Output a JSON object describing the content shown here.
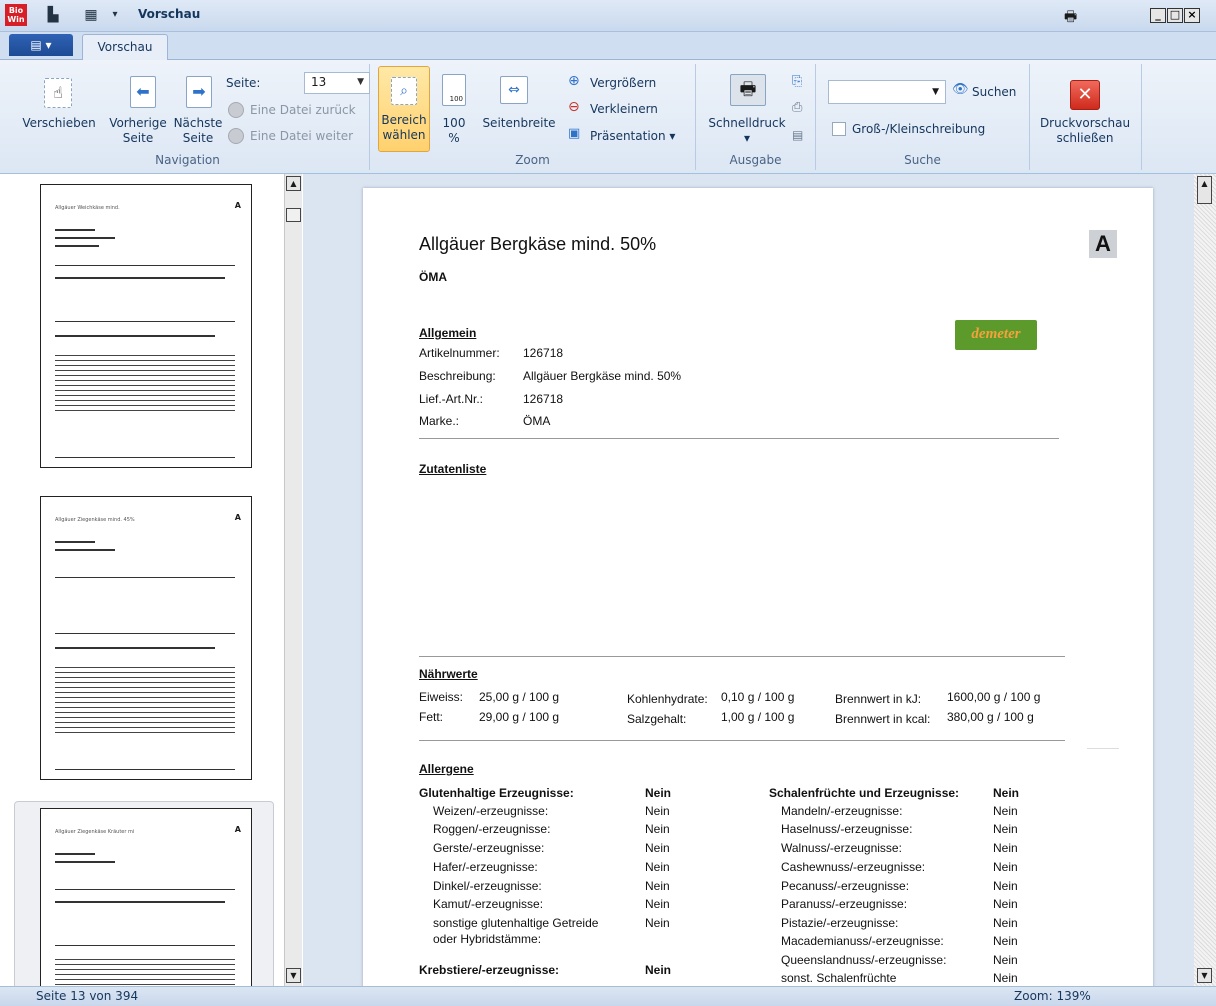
{
  "window": {
    "title": "Vorschau",
    "logo_text": "Bio\nWin",
    "min": "_",
    "max": "□",
    "close": "×"
  },
  "tabs": {
    "menu": "▤ ▾",
    "active": "Vorschau"
  },
  "ribbon": {
    "navigation": {
      "label": "Navigation",
      "verschieben": "Verschieben",
      "vorherige_1": "Vorherige",
      "vorherige_2": "Seite",
      "naechste_1": "Nächste",
      "naechste_2": "Seite",
      "seite_label": "Seite:",
      "seite_value": "13",
      "datei_zurueck": "Eine Datei zurück",
      "datei_weiter": "Eine Datei weiter"
    },
    "zoom": {
      "label": "Zoom",
      "bereich_1": "Bereich",
      "bereich_2": "wählen",
      "hundert_1": "100",
      "hundert_2": "%",
      "seitenbreite": "Seitenbreite",
      "vergroessern": "Vergrößern",
      "verkleinern": "Verkleinern",
      "praesentation": "Präsentation ▾"
    },
    "ausgabe": {
      "label": "Ausgabe",
      "schnelldruck": "Schnelldruck",
      "arrow": "▾"
    },
    "suche": {
      "label": "Suche",
      "suchen": "Suchen",
      "case_label": "Groß-/Kleinschreibung",
      "input_value": ""
    },
    "close": {
      "line1": "Druckvorschau",
      "line2": "schließen"
    }
  },
  "document": {
    "title": "Allgäuer Bergkäse mind. 50%",
    "subtitle": "ÖMA",
    "badge": "A",
    "brand_logo": "demeter",
    "allgemein": {
      "heading": "Allgemein",
      "rows": [
        {
          "label": "Artikelnummer:",
          "value": "126718"
        },
        {
          "label": "Beschreibung:",
          "value": "Allgäuer Bergkäse mind. 50%"
        },
        {
          "label": "Lief.-Art.Nr.:",
          "value": "126718"
        },
        {
          "label": "Marke.:",
          "value": "ÖMA"
        }
      ]
    },
    "zutatenliste": {
      "heading": "Zutatenliste"
    },
    "naehrwerte": {
      "heading": "Nährwerte",
      "eiweiss_l": "Eiweiss:",
      "eiweiss_v": "25,00 g / 100 g",
      "fett_l": "Fett:",
      "fett_v": "29,00 g / 100 g",
      "kh_l": "Kohlenhydrate:",
      "kh_v": "0,10 g / 100 g",
      "salz_l": "Salzgehalt:",
      "salz_v": "1,00 g / 100 g",
      "bkj_l": "Brennwert in kJ:",
      "bkj_v": "1600,00 g / 100 g",
      "bkcal_l": "Brennwert in kcal:",
      "bkcal_v": "380,00 g / 100 g"
    },
    "allergene": {
      "heading": "Allergene",
      "gluten_head": "Glutenhaltige Erzeugnisse:",
      "gluten_head_v": "Nein",
      "gluten_items": [
        {
          "label": "Weizen/-erzeugnisse:",
          "value": "Nein"
        },
        {
          "label": "Roggen/-erzeugnisse:",
          "value": "Nein"
        },
        {
          "label": "Gerste/-erzeugnisse:",
          "value": "Nein"
        },
        {
          "label": "Hafer/-erzeugnisse:",
          "value": "Nein"
        },
        {
          "label": "Dinkel/-erzeugnisse:",
          "value": "Nein"
        },
        {
          "label": "Kamut/-erzeugnisse:",
          "value": "Nein"
        },
        {
          "label": "sonstige glutenhaltige Getreide",
          "value": "Nein"
        },
        {
          "label": "oder Hybridstämme:",
          "value": ""
        }
      ],
      "krebs_head": "Krebstiere/-erzeugnisse:",
      "krebs_head_v": "Nein",
      "schalen_head": "Schalenfrüchte und Erzeugnisse:",
      "schalen_head_v": "Nein",
      "schalen_items": [
        {
          "label": "Mandeln/-erzeugnisse:",
          "value": "Nein"
        },
        {
          "label": "Haselnuss/-erzeugnisse:",
          "value": "Nein"
        },
        {
          "label": "Walnuss/-erzeugnisse:",
          "value": "Nein"
        },
        {
          "label": "Cashewnuss/-erzeugnisse:",
          "value": "Nein"
        },
        {
          "label": "Pecanuss/-erzeugnisse:",
          "value": "Nein"
        },
        {
          "label": "Paranuss/-erzeugnisse:",
          "value": "Nein"
        },
        {
          "label": "Pistazie/-erzeugnisse:",
          "value": "Nein"
        },
        {
          "label": "Macademianuss/-erzeugnisse:",
          "value": "Nein"
        },
        {
          "label": "Queenslandnuss/-erzeugnisse:",
          "value": "Nein"
        },
        {
          "label": "sonst. Schalenfrüchte",
          "value": "Nein"
        }
      ]
    }
  },
  "thumbnails": [
    {
      "title": "Allgäuer Weichkäse mind.",
      "badge": "A"
    },
    {
      "title": "Allgäuer Ziegenkäse mind. 45%",
      "badge": "A"
    },
    {
      "title": "Allgäuer Ziegenkäse Kräuter mi",
      "badge": "A"
    }
  ],
  "status": {
    "page": "Seite 13 von 394",
    "zoom": "Zoom: 139%"
  }
}
